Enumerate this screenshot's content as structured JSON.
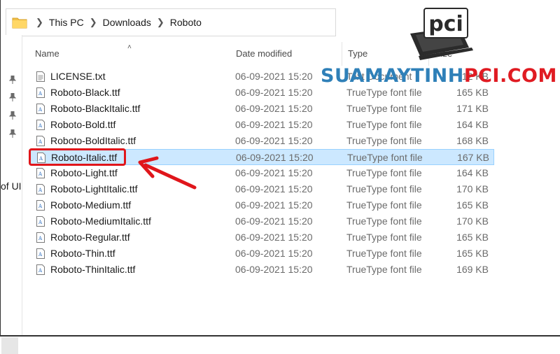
{
  "address_bar": {
    "crumbs": [
      "This PC",
      "Downloads",
      "Roboto"
    ]
  },
  "nav_pane": {
    "cut_text": "of UI"
  },
  "columns": {
    "name": "Name",
    "date": "Date modified",
    "type": "Type",
    "size": "Size"
  },
  "files": [
    {
      "name": "LICENSE.txt",
      "date": "06-09-2021 15:20",
      "type": "Text Document",
      "size": "12 KB",
      "icon": "text-file-icon"
    },
    {
      "name": "Roboto-Black.ttf",
      "date": "06-09-2021 15:20",
      "type": "TrueType font file",
      "size": "165 KB",
      "icon": "font-file-icon"
    },
    {
      "name": "Roboto-BlackItalic.ttf",
      "date": "06-09-2021 15:20",
      "type": "TrueType font file",
      "size": "171 KB",
      "icon": "font-file-icon"
    },
    {
      "name": "Roboto-Bold.ttf",
      "date": "06-09-2021 15:20",
      "type": "TrueType font file",
      "size": "164 KB",
      "icon": "font-file-icon"
    },
    {
      "name": "Roboto-BoldItalic.ttf",
      "date": "06-09-2021 15:20",
      "type": "TrueType font file",
      "size": "168 KB",
      "icon": "font-file-icon"
    },
    {
      "name": "Roboto-Italic.ttf",
      "date": "06-09-2021 15:20",
      "type": "TrueType font file",
      "size": "167 KB",
      "icon": "font-file-icon",
      "selected": true
    },
    {
      "name": "Roboto-Light.ttf",
      "date": "06-09-2021 15:20",
      "type": "TrueType font file",
      "size": "164 KB",
      "icon": "font-file-icon"
    },
    {
      "name": "Roboto-LightItalic.ttf",
      "date": "06-09-2021 15:20",
      "type": "TrueType font file",
      "size": "170 KB",
      "icon": "font-file-icon"
    },
    {
      "name": "Roboto-Medium.ttf",
      "date": "06-09-2021 15:20",
      "type": "TrueType font file",
      "size": "165 KB",
      "icon": "font-file-icon"
    },
    {
      "name": "Roboto-MediumItalic.ttf",
      "date": "06-09-2021 15:20",
      "type": "TrueType font file",
      "size": "170 KB",
      "icon": "font-file-icon"
    },
    {
      "name": "Roboto-Regular.ttf",
      "date": "06-09-2021 15:20",
      "type": "TrueType font file",
      "size": "165 KB",
      "icon": "font-file-icon"
    },
    {
      "name": "Roboto-Thin.ttf",
      "date": "06-09-2021 15:20",
      "type": "TrueType font file",
      "size": "165 KB",
      "icon": "font-file-icon"
    },
    {
      "name": "Roboto-ThinItalic.ttf",
      "date": "06-09-2021 15:20",
      "type": "TrueType font file",
      "size": "169 KB",
      "icon": "font-file-icon"
    }
  ],
  "watermark": {
    "part1": "SUAMAYTINH",
    "part2": "PCI.COM",
    "logo_text": "pci"
  },
  "colors": {
    "selection_bg": "#cce8ff",
    "highlight_red": "#e0161b",
    "watermark_blue": "#2f80b8"
  }
}
